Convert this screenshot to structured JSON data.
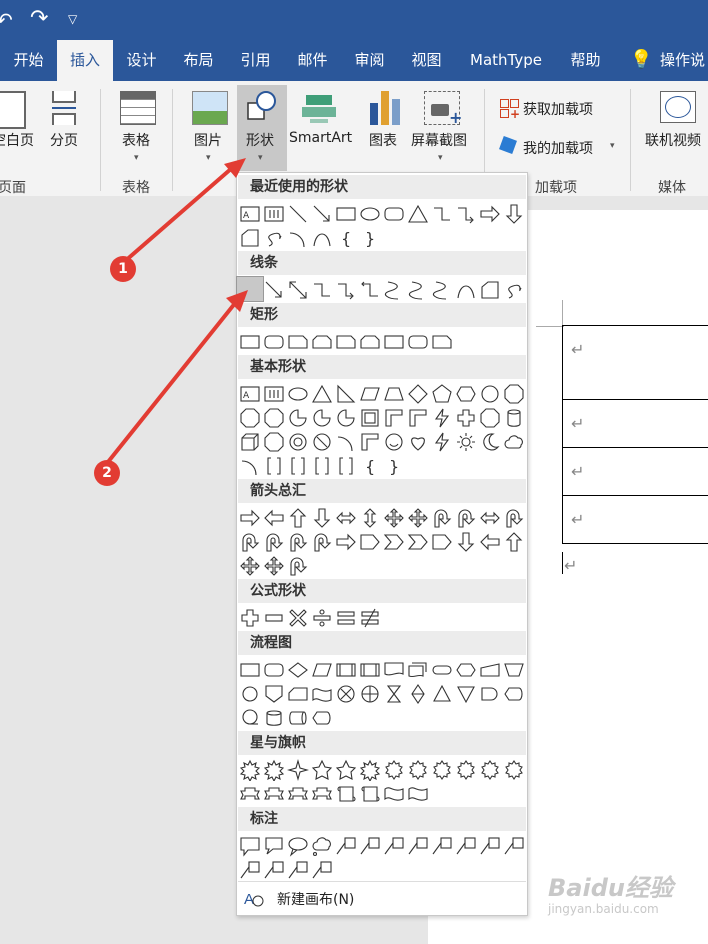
{
  "titlebar": {
    "undo_icon": "undo-icon",
    "redo_icon": "redo-icon",
    "qat_more_icon": "qat-dropdown-icon"
  },
  "tabs": [
    {
      "label": "开始"
    },
    {
      "label": "插入"
    },
    {
      "label": "设计"
    },
    {
      "label": "布局"
    },
    {
      "label": "引用"
    },
    {
      "label": "邮件"
    },
    {
      "label": "审阅"
    },
    {
      "label": "视图"
    },
    {
      "label": "MathType"
    },
    {
      "label": "帮助"
    },
    {
      "label": "操作说"
    }
  ],
  "ribbon": {
    "blank_page": "空白页",
    "page_break": "分页",
    "pages_group": "页面",
    "table": "表格",
    "tables_group": "表格",
    "picture": "图片",
    "shapes": "形状",
    "smartart": "SmartArt",
    "chart": "图表",
    "screenshot": "屏幕截图",
    "get_addins": "获取加载项",
    "my_addins": "我的加载项",
    "addins_group": "加载项",
    "online_video": "联机视频",
    "media_group": "媒体"
  },
  "dropdown": {
    "sections": {
      "recent": "最近使用的形状",
      "lines": "线条",
      "rect": "矩形",
      "basic": "基本形状",
      "arrows": "箭头总汇",
      "equation": "公式形状",
      "flowchart": "流程图",
      "stars": "星与旗帜",
      "callouts": "标注"
    },
    "new_canvas": "新建画布(N)"
  },
  "annotations": {
    "badge1": "1",
    "badge2": "2",
    "color": "#e23c33"
  },
  "watermark": {
    "brand": "Baidu经验",
    "url": "jingyan.baidu.com"
  },
  "colors": {
    "accent": "#2b579a"
  }
}
